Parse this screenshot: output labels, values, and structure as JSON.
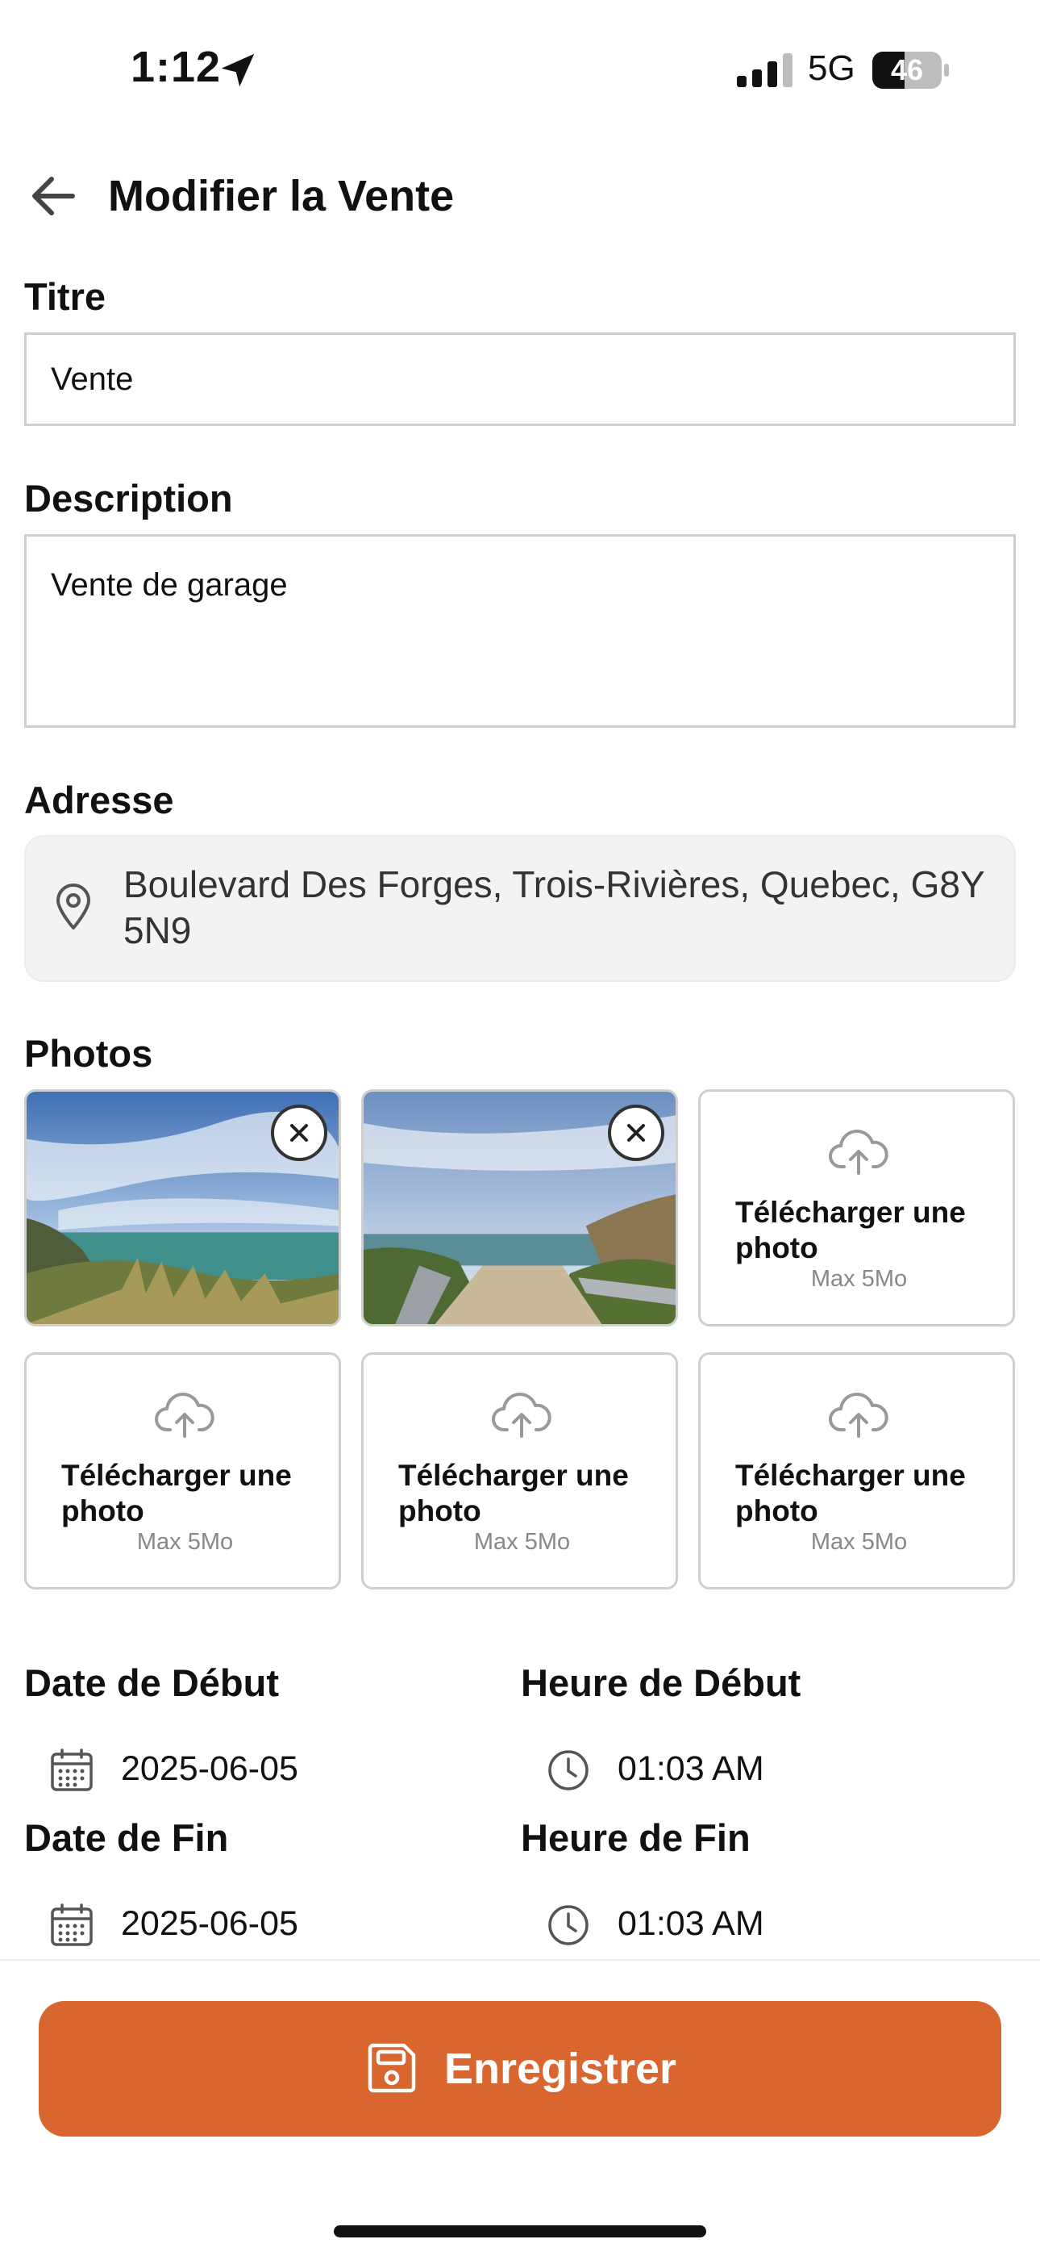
{
  "status_bar": {
    "time": "1:12",
    "network": "5G",
    "battery": "46"
  },
  "header": {
    "title": "Modifier la Vente"
  },
  "form": {
    "title_label": "Titre",
    "title_value": "Vente",
    "description_label": "Description",
    "description_value": "Vente de garage",
    "address_label": "Adresse",
    "address_value": "Boulevard Des Forges, Trois-Rivières, Quebec, G8Y 5N9",
    "photos_label": "Photos",
    "upload_title": "Télécharger une photo",
    "upload_sub": "Max 5Mo",
    "start_date_label": "Date de Début",
    "start_date_value": "2025-06-05",
    "start_time_label": "Heure de Début",
    "start_time_value": "01:03 AM",
    "end_date_label": "Date de Fin",
    "end_date_value": "2025-06-05",
    "end_time_label": "Heure de Fin",
    "end_time_value": "01:03 AM"
  },
  "actions": {
    "save_label": "Enregistrer"
  },
  "colors": {
    "accent": "#d9652f"
  },
  "icons": [
    "back-arrow-icon",
    "location-pin-icon",
    "close-icon",
    "cloud-upload-icon",
    "calendar-icon",
    "clock-icon",
    "save-icon"
  ]
}
